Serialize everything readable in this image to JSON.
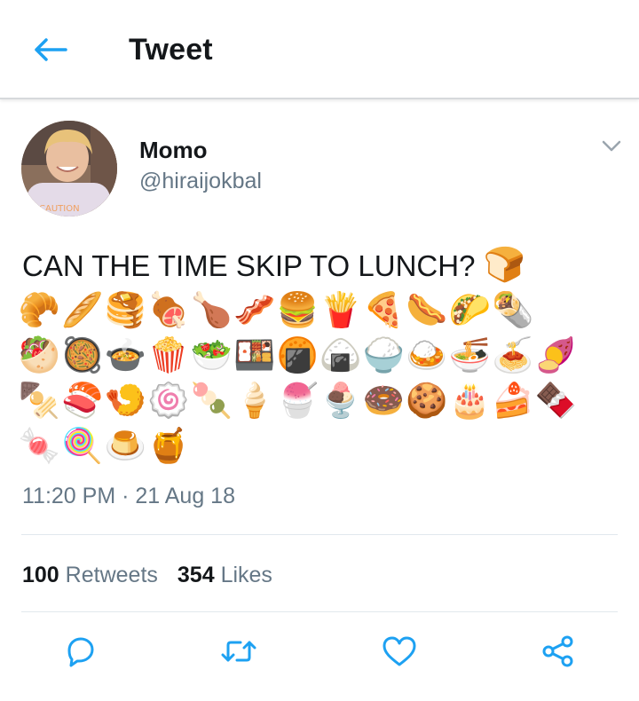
{
  "header": {
    "title": "Tweet",
    "back_icon": "back-arrow-icon"
  },
  "author": {
    "display_name": "Momo",
    "handle": "@hiraijokbal",
    "avatar_shirt_text": "CAUTION"
  },
  "tweet": {
    "text": "CAN THE TIME SKIP TO LUNCH?",
    "emojis": [
      "🍞",
      "🥐",
      "🥖",
      "🥞",
      "🍖",
      "🍗",
      "🥓",
      "🍔",
      "🍟",
      "🍕",
      "🌭",
      "🌮",
      "🌯",
      "🥙",
      "🥘",
      "🍲",
      "🍿",
      "🥗",
      "🍱",
      "🍘",
      "🍙",
      "🍚",
      "🍛",
      "🍜",
      "🍝",
      "🍠",
      "🍢",
      "🍣",
      "🍤",
      "🍥",
      "🍡",
      "🍦",
      "🍧",
      "🍨",
      "🍩",
      "🍪",
      "🎂",
      "🍰",
      "🍫",
      "🍬",
      "🍭",
      "🍮",
      "🍯"
    ],
    "timestamp": "11:20 PM · 21 Aug 18"
  },
  "stats": {
    "retweets_count": "100",
    "retweets_label": "Retweets",
    "likes_count": "354",
    "likes_label": "Likes"
  },
  "actions": {
    "reply_icon": "reply-icon",
    "retweet_icon": "retweet-icon",
    "like_icon": "heart-icon",
    "share_icon": "share-icon"
  },
  "colors": {
    "accent": "#1da1f2",
    "text_primary": "#14171a",
    "text_secondary": "#657786",
    "divider": "#e1e8ed"
  }
}
